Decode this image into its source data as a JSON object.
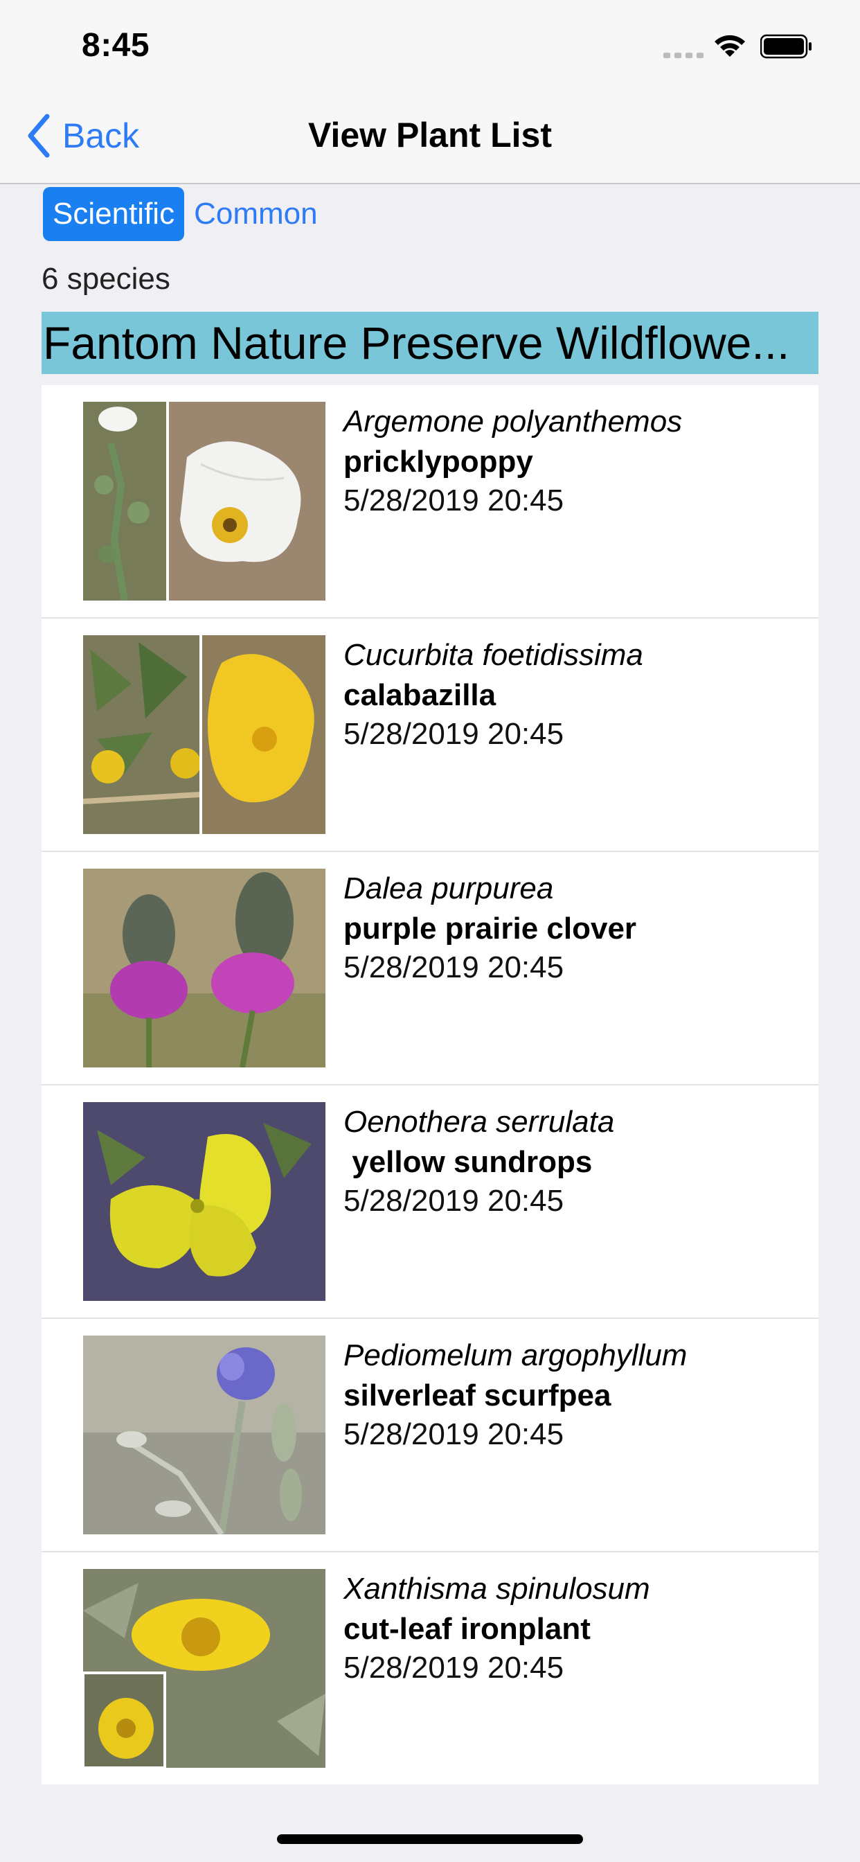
{
  "status_bar": {
    "time": "8:45"
  },
  "nav": {
    "back_label": "Back",
    "title": "View Plant List"
  },
  "segmented_control": {
    "options": [
      "Scientific",
      "Common"
    ],
    "selected": "Scientific"
  },
  "list": {
    "count_label": "6 species",
    "header_title": "Fantom Nature Preserve Wildflowe...",
    "items": [
      {
        "scientific": "Argemone polyanthemos",
        "common": "pricklypoppy",
        "date": "5/28/2019 20:45"
      },
      {
        "scientific": "Cucurbita foetidissima",
        "common": "calabazilla",
        "date": "5/28/2019 20:45"
      },
      {
        "scientific": "Dalea purpurea",
        "common": "purple prairie clover",
        "date": "5/28/2019 20:45"
      },
      {
        "scientific": "Oenothera serrulata",
        "common": " yellow sundrops",
        "date": "5/28/2019 20:45"
      },
      {
        "scientific": "Pediomelum argophyllum",
        "common": "silverleaf scurfpea",
        "date": "5/28/2019 20:45"
      },
      {
        "scientific": "Xanthisma spinulosum",
        "common": "cut-leaf ironplant",
        "date": "5/28/2019 20:45"
      }
    ]
  },
  "colors": {
    "accent": "#2d7cf6",
    "header_bg": "#78c6d8",
    "segment_selected": "#1a7ff0"
  }
}
